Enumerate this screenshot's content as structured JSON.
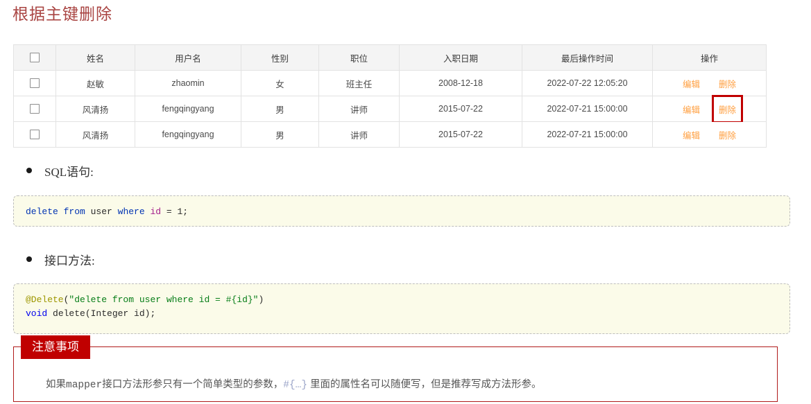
{
  "page": {
    "title": "根据主键删除",
    "title_color": "#a94442"
  },
  "table": {
    "select_all_checkbox": "",
    "columns": [
      {
        "key": "check",
        "label": ""
      },
      {
        "key": "name",
        "label": "姓名"
      },
      {
        "key": "user",
        "label": "用户名"
      },
      {
        "key": "gender",
        "label": "性别"
      },
      {
        "key": "job",
        "label": "职位"
      },
      {
        "key": "hire",
        "label": "入职日期"
      },
      {
        "key": "last",
        "label": "最后操作时间"
      },
      {
        "key": "op",
        "label": "操作"
      }
    ],
    "rows": [
      {
        "name": "赵敏",
        "user": "zhaomin",
        "gender": "女",
        "job": "班主任",
        "hire": "2008-12-18",
        "last": "2022-07-22 12:05:20",
        "edit": "编辑",
        "delete": "删除",
        "delete_highlighted": false
      },
      {
        "name": "风清扬",
        "user": "fengqingyang",
        "gender": "男",
        "job": "讲师",
        "hire": "2015-07-22",
        "last": "2022-07-21 15:00:00",
        "edit": "编辑",
        "delete": "删除",
        "delete_highlighted": true
      },
      {
        "name": "风清扬",
        "user": "fengqingyang",
        "gender": "男",
        "job": "讲师",
        "hire": "2015-07-22",
        "last": "2022-07-21 15:00:00",
        "edit": "编辑",
        "delete": "删除",
        "delete_highlighted": false
      }
    ],
    "action_link_color": "#ff9f40",
    "highlight_color": "#c00000"
  },
  "sections": [
    {
      "heading": "SQL语句:",
      "code_lines": [
        [
          {
            "text": "delete from ",
            "color": "blue"
          },
          {
            "text": "user ",
            "color": "plain"
          },
          {
            "text": "where ",
            "color": "blue"
          },
          {
            "text": "id",
            "color": "purple"
          },
          {
            "text": " = 1;",
            "color": "plain"
          }
        ]
      ]
    },
    {
      "heading": "接口方法:",
      "code_lines": [
        [
          {
            "text": "@Delete",
            "color": "gold"
          },
          {
            "text": "(",
            "color": "plain"
          },
          {
            "text": "\"delete from user where id = #{id}\"",
            "color": "green"
          },
          {
            "text": ")",
            "color": "plain"
          }
        ],
        [
          {
            "text": "void ",
            "color": "bluekw"
          },
          {
            "text": "delete(Integer id);",
            "color": "plain"
          }
        ]
      ]
    }
  ],
  "notice": {
    "tag": "注意事项",
    "text_before": "如果",
    "text_mono": "mapper",
    "text_middle": "接口方法形参只有一个简单类型的参数，",
    "text_hash": "#{…}",
    "text_after": " 里面的属性名可以随便写，但是推荐写成方法形参。",
    "border_color": "#b01a1a",
    "tag_bg": "#c00000"
  }
}
